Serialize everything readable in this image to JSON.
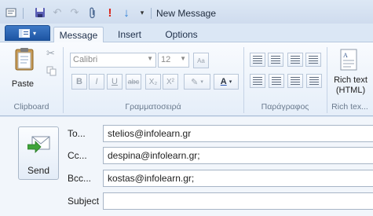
{
  "window": {
    "title": "New Message"
  },
  "ribbon_tabs": [
    {
      "label": "Message",
      "active": true
    },
    {
      "label": "Insert",
      "active": false
    },
    {
      "label": "Options",
      "active": false
    }
  ],
  "clipboard": {
    "paste_label": "Paste",
    "group_label": "Clipboard"
  },
  "font": {
    "family": "Calibri",
    "size": "12",
    "group_label": "Γραμματοσειρά"
  },
  "paragraph": {
    "group_label": "Παράγραφος"
  },
  "richtext": {
    "label_line1": "Rich text",
    "label_line2": "(HTML)",
    "group_label": "Rich tex..."
  },
  "compose": {
    "send_label": "Send",
    "to_label": "To...",
    "to_value": "stelios@infolearn.gr",
    "cc_label": "Cc...",
    "cc_value": "despina@infolearn.gr;",
    "bcc_label": "Bcc...",
    "bcc_value": "kostas@infolearn.gr;",
    "subject_label": "Subject",
    "subject_value": ""
  },
  "colors": {
    "accent": "#1d55a3",
    "priority_high": "#d9261c",
    "priority_low": "#2f7fd6"
  }
}
